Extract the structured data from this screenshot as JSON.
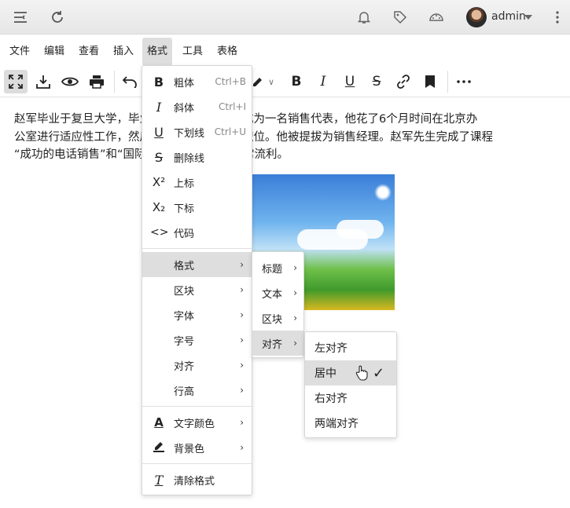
{
  "topbar": {
    "user": "admin",
    "icons": [
      "menu-toggle-icon",
      "refresh-icon",
      "bell-icon",
      "tag-icon",
      "palette-icon",
      "more-vertical-icon"
    ]
  },
  "menubar": [
    "文件",
    "编辑",
    "查看",
    "插入",
    "格式",
    "工具",
    "表格"
  ],
  "content": {
    "line1": "赵军毕业于复旦大学，毕业后他立即加入公司成为一名销售代表，他花了6个月时间在北京办",
    "line2": "公室进行适应性工作，然后被分配到一个固定职位。他被提拔为销售经理。赵军先生完成了课程",
    "line3": "“成功的电话销售”和“国际销售”。他的法语非常流利。"
  },
  "format_menu": {
    "bold": {
      "label": "粗体",
      "shortcut": "Ctrl+B"
    },
    "italic": {
      "label": "斜体",
      "shortcut": "Ctrl+I"
    },
    "underline": {
      "label": "下划线",
      "shortcut": "Ctrl+U"
    },
    "strike": {
      "label": "删除线"
    },
    "superscript": {
      "label": "上标"
    },
    "subscript": {
      "label": "下标"
    },
    "code": {
      "label": "代码"
    },
    "formats": {
      "label": "格式"
    },
    "blocks": {
      "label": "区块"
    },
    "fonts": {
      "label": "字体"
    },
    "fontsize": {
      "label": "字号"
    },
    "align": {
      "label": "对齐"
    },
    "lineheight": {
      "label": "行高"
    },
    "forecolor": {
      "label": "文字颜色"
    },
    "backcolor": {
      "label": "背景色"
    },
    "clear": {
      "label": "清除格式"
    }
  },
  "formats_submenu": {
    "headings": "标题",
    "inline": "文本",
    "blocks": "区块",
    "align": "对齐"
  },
  "align_submenu": {
    "left": "左对齐",
    "center": "居中",
    "right": "右对齐",
    "justify": "两端对齐"
  },
  "menu_icons": {
    "superscript_sym": "X²",
    "subscript_sym": "X₂",
    "code_sym": "<>",
    "chevron": "›",
    "check": "✓"
  }
}
